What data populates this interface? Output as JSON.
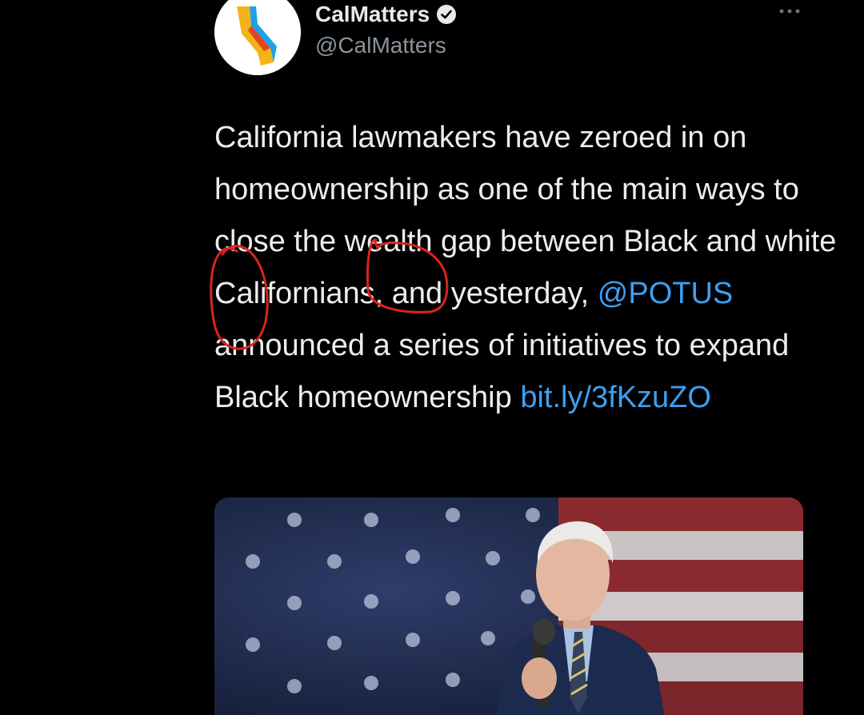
{
  "tweet": {
    "author": {
      "display_name": "CalMatters",
      "handle": "@CalMatters",
      "verified": true,
      "avatar_icon": "calmatters-logo"
    },
    "more_icon": "more-options-icon",
    "text": {
      "part1": "California lawmakers have zeroed in on homeownership as one of the main ways to close the wealth gap between Black and white Californians, and yesterday, ",
      "mention": "@POTUS",
      "part2": " announced a series of initiatives to expand Black homeownership ",
      "link": "bit.ly/3fKzuZO"
    },
    "media": {
      "type": "photo"
    }
  },
  "colors": {
    "background": "#000000",
    "text": "#e7e9ea",
    "secondary_text": "#8b949c",
    "link": "#3d9ff0",
    "annotation": "#d9251c"
  }
}
